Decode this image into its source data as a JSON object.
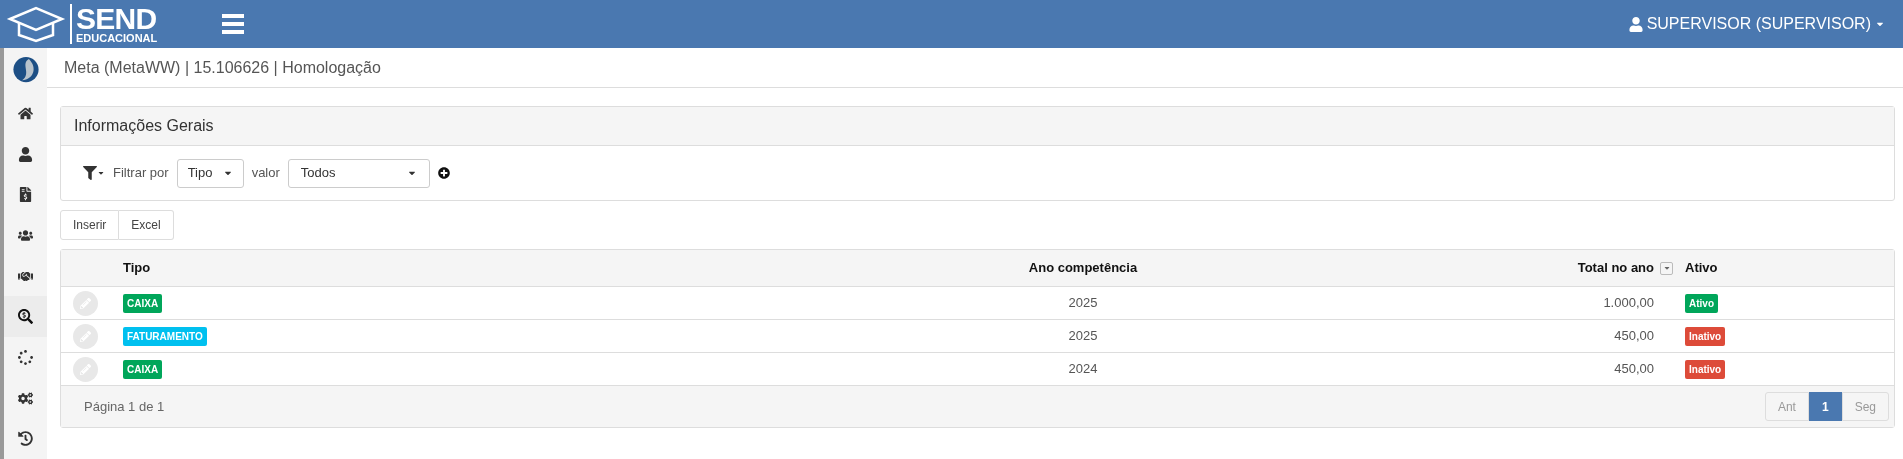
{
  "header": {
    "logo_title": "SEND",
    "logo_subtitle": "EDUCACIONAL",
    "user": "SUPERVISOR (SUPERVISOR)"
  },
  "sidebar": {
    "items": [
      {
        "kind": "home",
        "selected": false
      },
      {
        "kind": "user",
        "selected": false
      },
      {
        "kind": "invoice",
        "selected": false
      },
      {
        "kind": "users",
        "selected": false
      },
      {
        "kind": "handshake",
        "selected": false
      },
      {
        "kind": "search-money",
        "selected": true
      },
      {
        "kind": "spinner",
        "selected": false
      },
      {
        "kind": "gears",
        "selected": false
      },
      {
        "kind": "history",
        "selected": false
      }
    ]
  },
  "breadcrumb": "Meta (MetaWW) | 15.106626 | Homologação",
  "panel": {
    "title": "Informações Gerais",
    "filter_label": "Filtrar por",
    "filter_field": "Tipo",
    "value_label": "valor",
    "value_field": "Todos"
  },
  "actions": [
    "Inserir",
    "Excel"
  ],
  "table": {
    "columns": [
      "Tipo",
      "Ano competência",
      "Total no ano",
      "Ativo"
    ],
    "rows": [
      {
        "tipo": "CAIXA",
        "color": "#00a65a",
        "ano": "2025",
        "total": "1.000,00",
        "status": "Ativo",
        "active": true
      },
      {
        "tipo": "FATURAMENTO",
        "color": "#00c0ef",
        "ano": "2025",
        "total": "450,00",
        "status": "Inativo",
        "active": false
      },
      {
        "tipo": "CAIXA",
        "color": "#00a65a",
        "ano": "2024",
        "total": "450,00",
        "status": "Inativo",
        "active": false
      }
    ],
    "footer": "Página 1 de 1",
    "pagination": [
      {
        "label": "Ant",
        "selected": false
      },
      {
        "label": "1",
        "selected": true
      },
      {
        "label": "Seg",
        "selected": false
      }
    ]
  }
}
